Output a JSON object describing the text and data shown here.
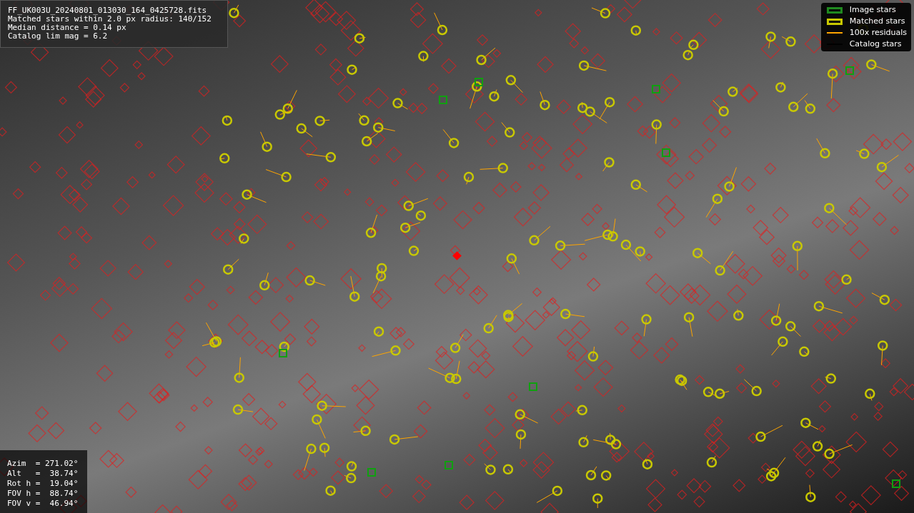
{
  "info_panel": {
    "lines": [
      "FF_UK003U_20240801_013030_164_0425728.fits",
      "Matched stars within 2.0 px radius: 140/152",
      "Median distance = 0.14 px",
      "Catalog lim mag = 6.2"
    ]
  },
  "legend": {
    "items": [
      {
        "kind": "image",
        "label": "Image stars",
        "color": "#1f8a1f"
      },
      {
        "kind": "matched",
        "label": "Matched stars",
        "color": "#c8c800"
      },
      {
        "kind": "residual",
        "label": "100x residuals",
        "color": "#ffa500"
      },
      {
        "kind": "catalog",
        "label": "Catalog stars",
        "color": "#000000"
      }
    ]
  },
  "pointing": {
    "lines": [
      "Azim  = 271.02°",
      "Alt   =  38.74°",
      "Rot h =  19.04°",
      "FOV h =  88.74°",
      "FOV v =  46.94°"
    ]
  }
}
